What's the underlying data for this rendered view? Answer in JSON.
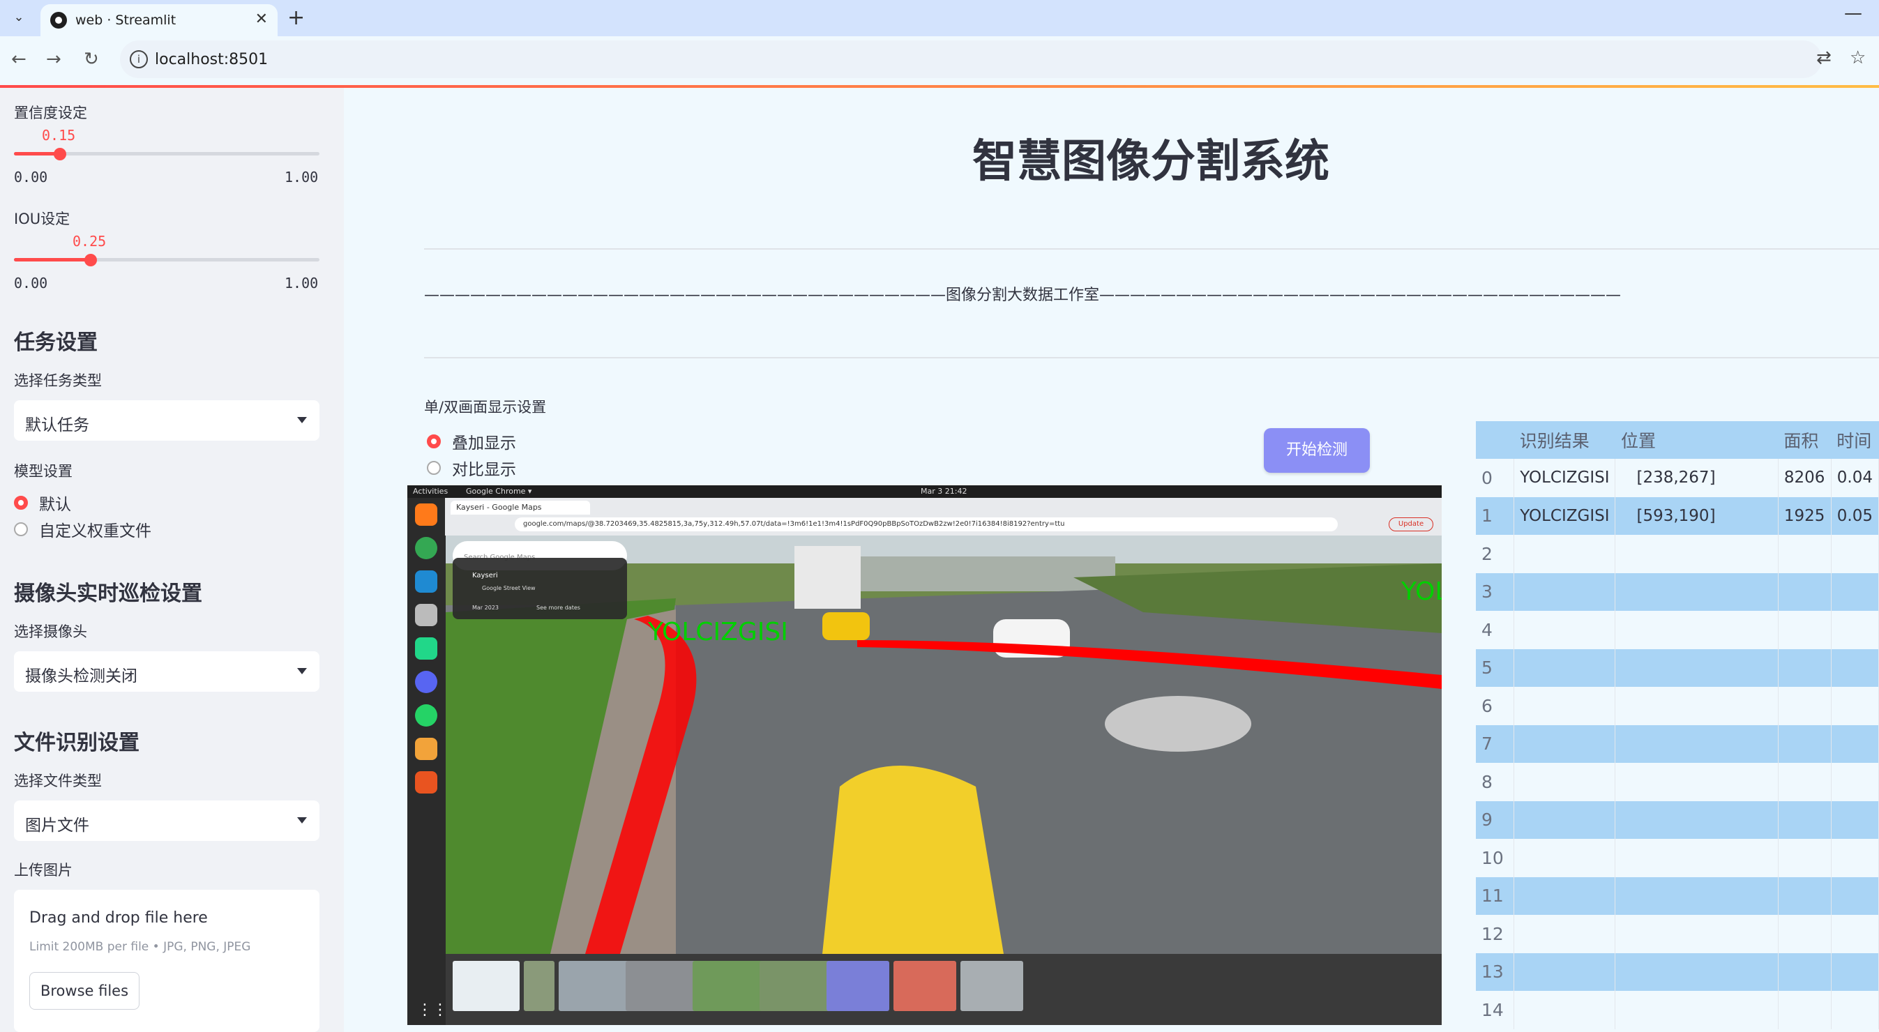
{
  "browser": {
    "tab_title": "web · Streamlit",
    "url": "localhost:8501"
  },
  "sidebar": {
    "confidence": {
      "label": "置信度设定",
      "value": "0.15",
      "min": "0.00",
      "max": "1.00",
      "fraction": 0.15
    },
    "iou": {
      "label": "IOU设定",
      "value": "0.25",
      "min": "0.00",
      "max": "1.00",
      "fraction": 0.25
    },
    "task_heading": "任务设置",
    "task_type_label": "选择任务类型",
    "task_type_value": "默认任务",
    "model_label": "模型设置",
    "model_options": [
      "默认",
      "自定义权重文件"
    ],
    "camera_heading": "摄像头实时巡检设置",
    "camera_label": "选择摄像头",
    "camera_value": "摄像头检测关闭",
    "file_heading": "文件识别设置",
    "file_type_label": "选择文件类型",
    "file_type_value": "图片文件",
    "upload_label": "上传图片",
    "upload_title": "Drag and drop file here",
    "upload_limit": "Limit 200MB per file • JPG, PNG, JPEG",
    "browse_label": "Browse files"
  },
  "main": {
    "title": "智慧图像分割系统",
    "studio_line": "——————————————————————————————————图像分割大数据工作室——————————————————————————————————",
    "display_label": "单/双画面显示设置",
    "display_options": [
      "叠加显示",
      "对比显示"
    ],
    "start_button": "开始检测",
    "detection_label": "YOLCIZGISI",
    "detection_label_partial": "YOL"
  },
  "screenshot_ui": {
    "activities": "Activities",
    "app": "Google Chrome ▾",
    "clock": "Mar 3  21:42",
    "tab": "Kayseri - Google Maps",
    "url": "google.com/maps/@38.7203469,35.4825815,3a,75y,312.49h,57.07t/data=!3m6!1e1!3m4!1sPdF0Q90pBBpSoTOzDwB2zw!2e0!7i16384!8i8192?entry=ttu",
    "search_placeholder": "Search Google Maps",
    "place": "Kayseri",
    "place_sub": "Google Street View",
    "date": "Mar 2023",
    "see_more": "See more dates",
    "update": "Update"
  },
  "table": {
    "columns": [
      "",
      "识别结果",
      "位置",
      "面积",
      "时间"
    ],
    "rows": [
      [
        "0",
        "YOLCIZGISI",
        "[238,267]",
        "8206",
        "0.04"
      ],
      [
        "1",
        "YOLCIZGISI",
        "[593,190]",
        "1925",
        "0.05"
      ],
      [
        "2",
        "",
        "",
        "",
        ""
      ],
      [
        "3",
        "",
        "",
        "",
        ""
      ],
      [
        "4",
        "",
        "",
        "",
        ""
      ],
      [
        "5",
        "",
        "",
        "",
        ""
      ],
      [
        "6",
        "",
        "",
        "",
        ""
      ],
      [
        "7",
        "",
        "",
        "",
        ""
      ],
      [
        "8",
        "",
        "",
        "",
        ""
      ],
      [
        "9",
        "",
        "",
        "",
        ""
      ],
      [
        "10",
        "",
        "",
        "",
        ""
      ],
      [
        "11",
        "",
        "",
        "",
        ""
      ],
      [
        "12",
        "",
        "",
        "",
        ""
      ],
      [
        "13",
        "",
        "",
        "",
        ""
      ],
      [
        "14",
        "",
        "",
        "",
        ""
      ]
    ]
  },
  "colors": {
    "accent": "#ff4b4b",
    "button": "#8b8ff5",
    "table_stripe": "#a9d4f5"
  }
}
